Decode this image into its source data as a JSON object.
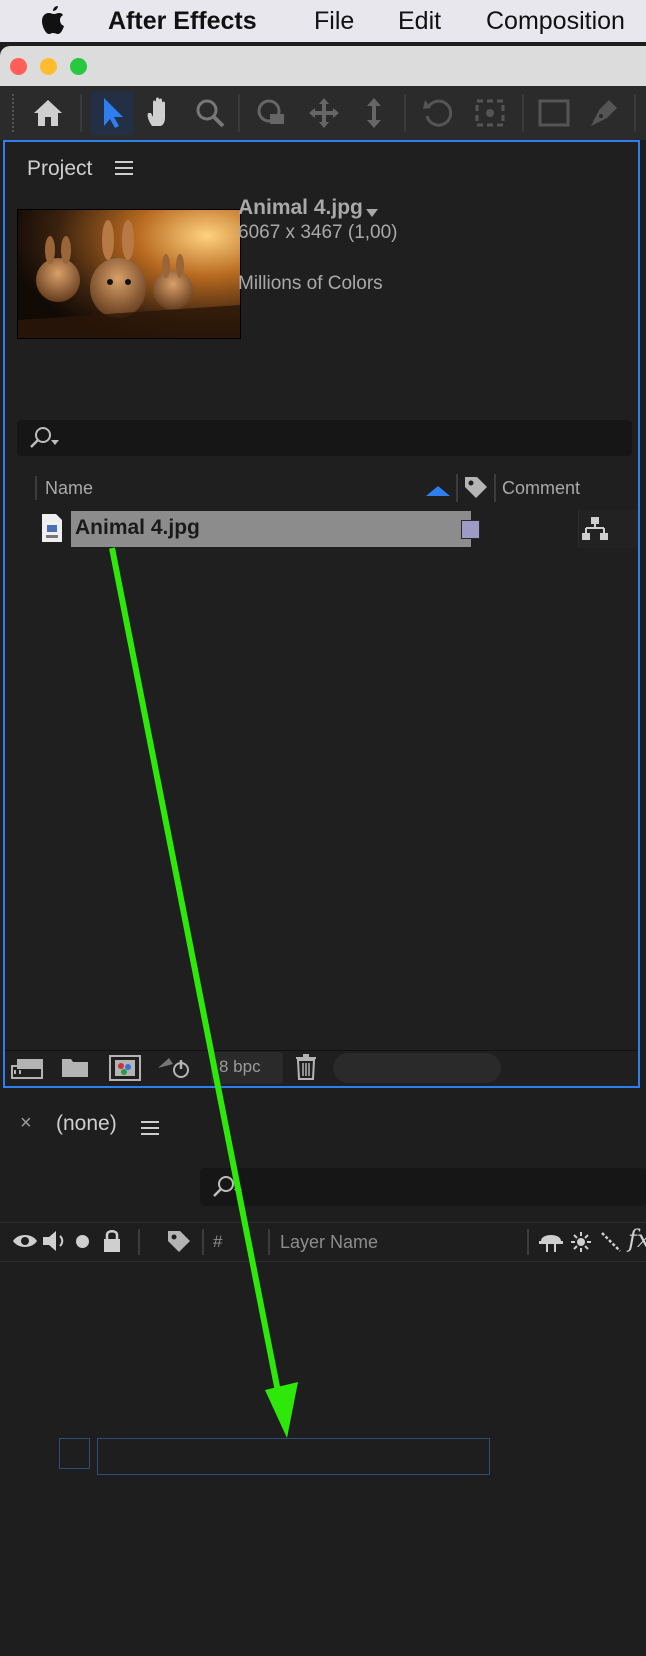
{
  "menubar": {
    "apple": "",
    "app": "After Effects",
    "file": "File",
    "edit": "Edit",
    "composition": "Composition"
  },
  "colors": {
    "accent": "#2f7ef0",
    "arrow": "#2ee80a",
    "label_swatch": "#9e9ac6"
  },
  "toolbar": {
    "icons": [
      "home-icon",
      "selection-tool-icon",
      "hand-tool-icon",
      "zoom-tool-icon",
      "orbit-camera-icon",
      "pan-camera-icon",
      "dolly-camera-icon",
      "rotate-tool-icon",
      "anchor-point-tool-icon",
      "rectangle-tool-icon",
      "pen-tool-icon"
    ]
  },
  "project": {
    "title": "Project",
    "preview": {
      "filename": "Animal 4.jpg",
      "dimensions": "6067 x 3467 (1,00)",
      "colors": "Millions of Colors"
    },
    "columns": {
      "name": "Name",
      "comment": "Comment"
    },
    "items": [
      {
        "name": "Animal 4.jpg"
      }
    ],
    "bpc": "8 bpc"
  },
  "timeline": {
    "close": "×",
    "title": "(none)",
    "columns": {
      "number": "#",
      "layer_name": "Layer Name"
    }
  }
}
